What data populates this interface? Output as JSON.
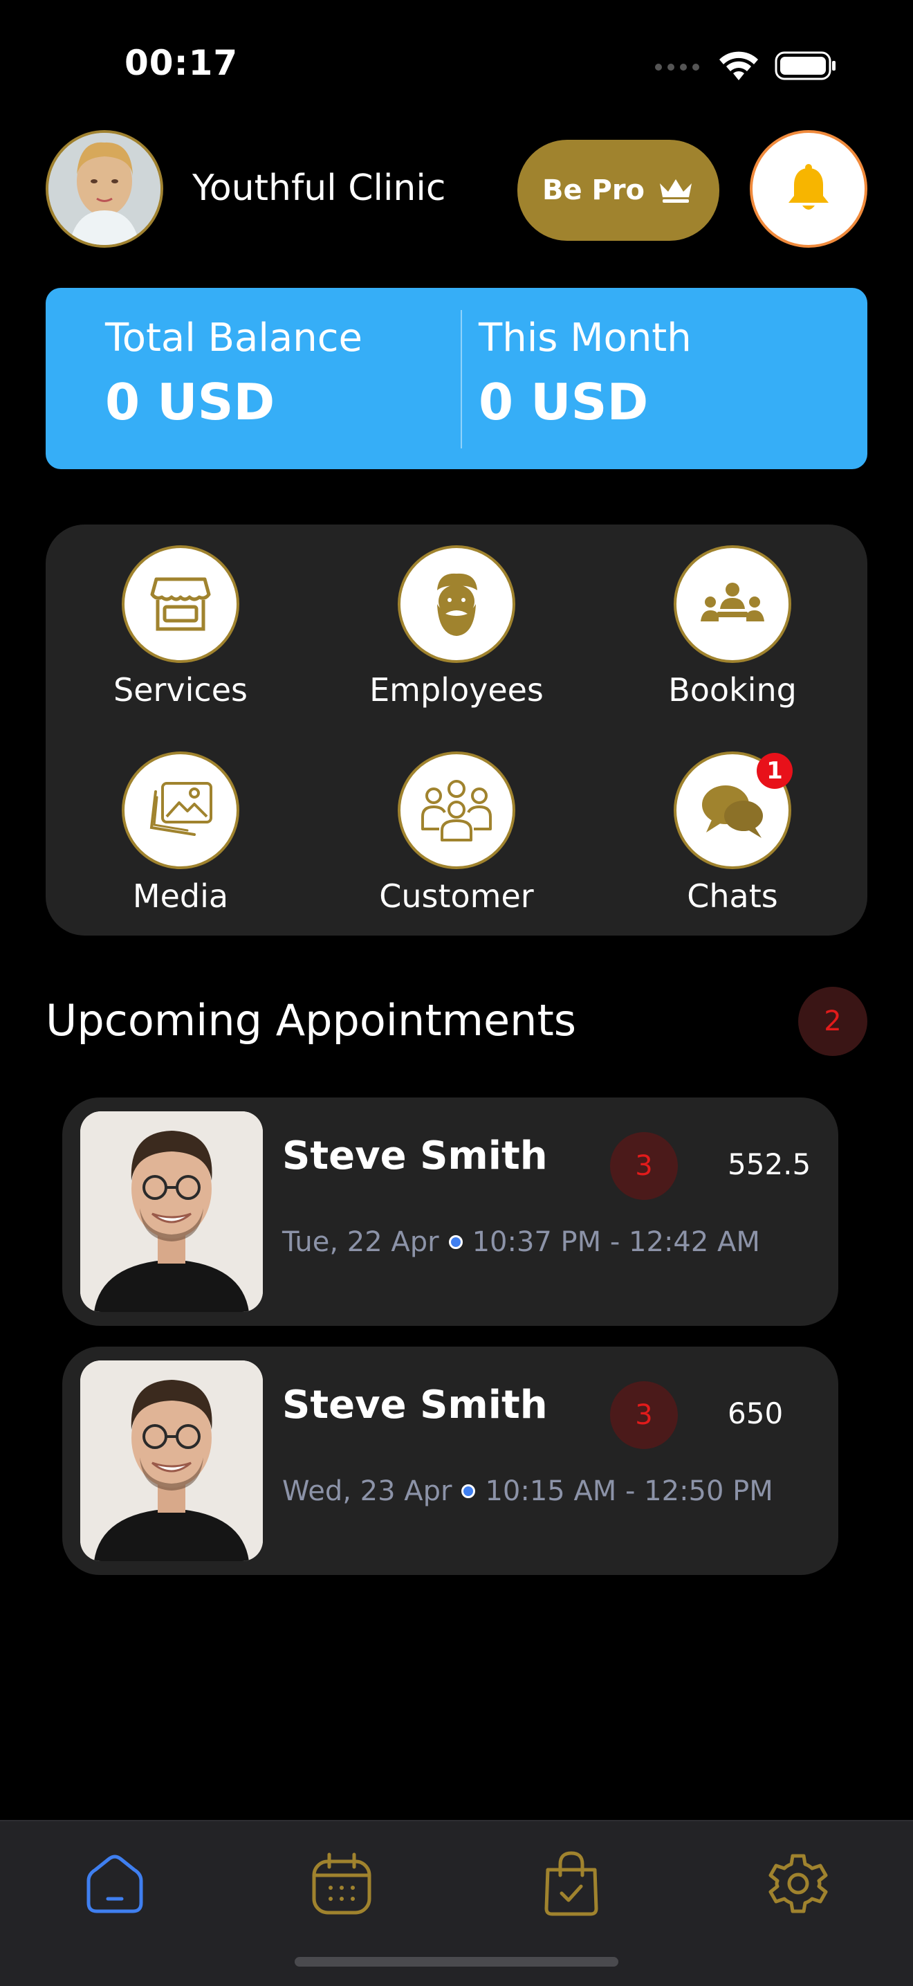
{
  "status": {
    "time": "00:17"
  },
  "header": {
    "clinic_name": "Youthful Clinic",
    "be_pro_label": "Be Pro",
    "accent_color": "#a0832e"
  },
  "balance": {
    "total_label": "Total Balance",
    "total_value": "0 USD",
    "month_label": "This Month",
    "month_value": "0 USD",
    "card_color": "#36aef7"
  },
  "menu": {
    "items": [
      {
        "label": "Services",
        "icon": "storefront-icon"
      },
      {
        "label": "Employees",
        "icon": "bearded-man-icon"
      },
      {
        "label": "Booking",
        "icon": "group-table-icon"
      },
      {
        "label": "Media",
        "icon": "image-gallery-icon"
      },
      {
        "label": "Customer",
        "icon": "people-group-icon"
      },
      {
        "label": "Chats",
        "icon": "chat-bubbles-icon",
        "badge": "1"
      }
    ]
  },
  "appointments": {
    "title": "Upcoming Appointments",
    "count": "2",
    "items": [
      {
        "name": "Steve Smith",
        "count": "3",
        "price": "552.5",
        "date": "Tue, 22 Apr",
        "time": "10:37 PM - 12:42 AM"
      },
      {
        "name": "Steve Smith",
        "count": "3",
        "price": "650",
        "date": "Wed, 23 Apr",
        "time": "10:15 AM - 12:50 PM"
      }
    ]
  },
  "tabs": [
    {
      "icon": "home-icon",
      "active": true
    },
    {
      "icon": "calendar-icon",
      "active": false
    },
    {
      "icon": "shopping-bag-check-icon",
      "active": false
    },
    {
      "icon": "gear-icon",
      "active": false
    }
  ]
}
